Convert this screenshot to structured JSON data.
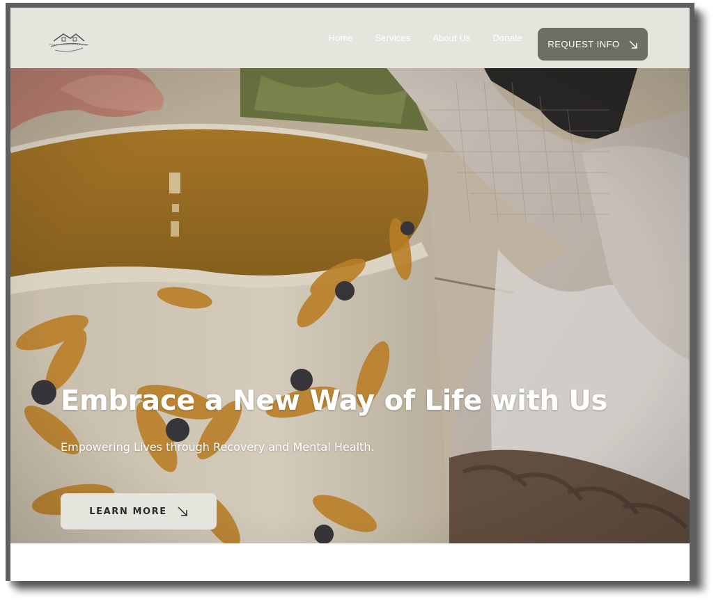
{
  "nav": {
    "logo_name": "house-logo",
    "links": [
      "Home",
      "Services",
      "About Us",
      "Donate"
    ],
    "cta_label": "REQUEST INFO",
    "cta_icon": "arrow-down-right-icon"
  },
  "hero": {
    "title": "Embrace a New Way of Life with Us",
    "subtitle": "Empowering Lives through Recovery and Mental Health.",
    "button_label": "LEARN MORE",
    "button_icon": "arrow-down-right-icon",
    "background": "mug-with-flower-pattern-photo"
  },
  "colors": {
    "nav_bg": "#e6e5dd",
    "cta_bg": "#6e6e64",
    "button_bg": "#e6e5dd",
    "frame": "#5e5e5e"
  }
}
